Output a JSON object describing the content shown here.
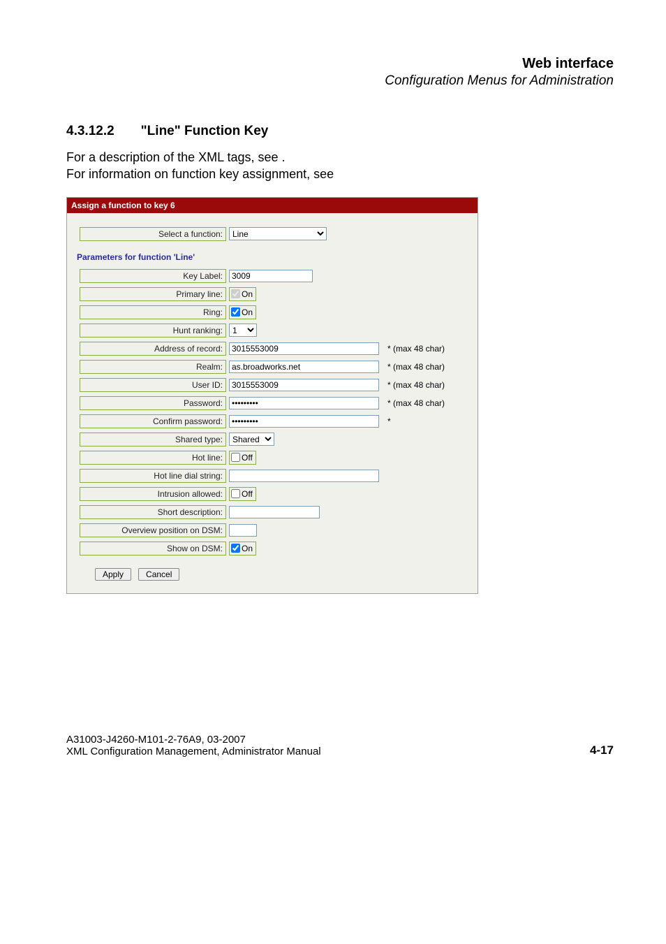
{
  "header": {
    "title": "Web interface",
    "subtitle": "Configuration Menus for Administration"
  },
  "section": {
    "number": "4.3.12.2",
    "title": "\"Line\" Function Key"
  },
  "body": {
    "line1": "For a description of the XML tags, see .",
    "line2": "For information on function key assignment, see"
  },
  "panel": {
    "title": "Assign a function to key 6",
    "select_function_label": "Select a function:",
    "select_function_value": "Line",
    "params_heading": "Parameters for function 'Line'",
    "rows": {
      "key_label": {
        "label": "Key Label:",
        "value": "3009"
      },
      "primary_line": {
        "label": "Primary line:",
        "state": "On",
        "checked": true,
        "disabled": true
      },
      "ring": {
        "label": "Ring:",
        "state": "On",
        "checked": true
      },
      "hunt_ranking": {
        "label": "Hunt ranking:",
        "value": "1"
      },
      "address_of_record": {
        "label": "Address of record:",
        "value": "3015553009",
        "hint": "* (max 48 char)"
      },
      "realm": {
        "label": "Realm:",
        "value": "as.broadworks.net",
        "hint": "* (max 48 char)"
      },
      "user_id": {
        "label": "User ID:",
        "value": "3015553009",
        "hint": "* (max 48 char)"
      },
      "password": {
        "label": "Password:",
        "value": "•••••••••",
        "hint": "* (max 48 char)"
      },
      "confirm_password": {
        "label": "Confirm password:",
        "value": "•••••••••",
        "hint": "*"
      },
      "shared_type": {
        "label": "Shared type:",
        "value": "Shared"
      },
      "hot_line": {
        "label": "Hot line:",
        "state": "Off",
        "checked": false
      },
      "hot_line_dial_string": {
        "label": "Hot line dial string:",
        "value": ""
      },
      "intrusion_allowed": {
        "label": "Intrusion allowed:",
        "state": "Off",
        "checked": false
      },
      "short_description": {
        "label": "Short description:",
        "value": ""
      },
      "overview_position_on_dsm": {
        "label": "Overview position on DSM:",
        "value": ""
      },
      "show_on_dsm": {
        "label": "Show on DSM:",
        "state": "On",
        "checked": true
      }
    },
    "buttons": {
      "apply": "Apply",
      "cancel": "Cancel"
    }
  },
  "footer": {
    "line1": "A31003-J4260-M101-2-76A9, 03-2007",
    "line2": "XML Configuration Management, Administrator Manual",
    "page": "4-17"
  }
}
